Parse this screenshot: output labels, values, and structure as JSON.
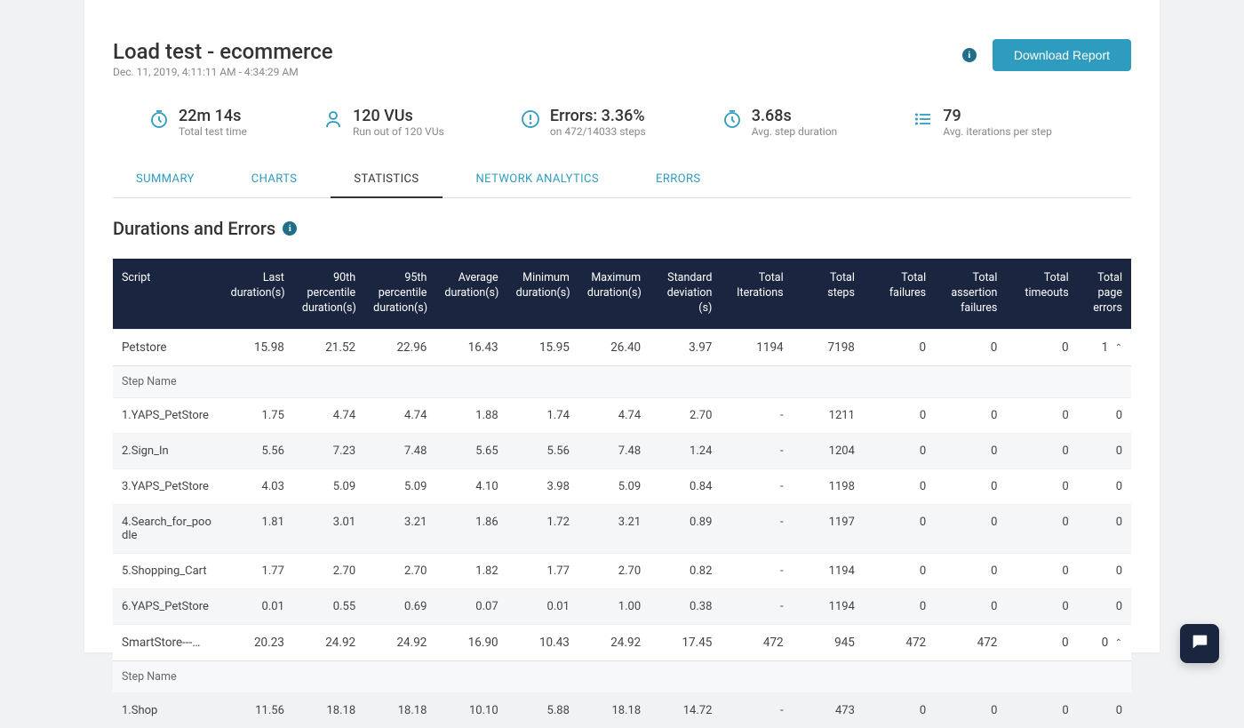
{
  "header": {
    "title": "Load test - ecommerce",
    "subtitle": "Dec. 11, 2019, 4:11:11 AM - 4:34:29 AM",
    "download_label": "Download Report"
  },
  "metrics": [
    {
      "icon": "clock",
      "value": "22m 14s",
      "label": "Total test time"
    },
    {
      "icon": "user",
      "value": "120 VUs",
      "label": "Run out of 120 VUs"
    },
    {
      "icon": "alert",
      "value": "Errors: 3.36%",
      "label": "on 472/14033 steps"
    },
    {
      "icon": "clock",
      "value": "3.68s",
      "label": "Avg. step duration"
    },
    {
      "icon": "list",
      "value": "79",
      "label": "Avg. iterations per step"
    }
  ],
  "tabs": [
    {
      "label": "SUMMARY",
      "active": false
    },
    {
      "label": "CHARTS",
      "active": false
    },
    {
      "label": "STATISTICS",
      "active": true
    },
    {
      "label": "NETWORK ANALYTICS",
      "active": false
    },
    {
      "label": "ERRORS",
      "active": false
    }
  ],
  "section": {
    "title": "Durations and Errors"
  },
  "table": {
    "columns": [
      "Script",
      "Last duration(s)",
      "90th percentile duration(s)",
      "95th percentile duration(s)",
      "Average duration(s)",
      "Minimum duration(s)",
      "Maximum duration(s)",
      "Standard deviation (s)",
      "Total Iterations",
      "Total steps",
      "Total failures",
      "Total assertion failures",
      "Total timeouts",
      "Total page errors"
    ],
    "step_header_label": "Step Name",
    "rows": [
      {
        "kind": "script",
        "cells": [
          "Petstore",
          "15.98",
          "21.52",
          "22.96",
          "16.43",
          "15.95",
          "26.40",
          "3.97",
          "1194",
          "7198",
          "0",
          "0",
          "0",
          "1"
        ]
      },
      {
        "kind": "step-header"
      },
      {
        "kind": "step",
        "cells": [
          "1.YAPS_PetStore",
          "1.75",
          "4.74",
          "4.74",
          "1.88",
          "1.74",
          "4.74",
          "2.70",
          "-",
          "1211",
          "0",
          "0",
          "0",
          "0"
        ]
      },
      {
        "kind": "step-alt",
        "cells": [
          "2.Sign_In",
          "5.56",
          "7.23",
          "7.48",
          "5.65",
          "5.56",
          "7.48",
          "1.24",
          "-",
          "1204",
          "0",
          "0",
          "0",
          "0"
        ]
      },
      {
        "kind": "step",
        "cells": [
          "3.YAPS_PetStore",
          "4.03",
          "5.09",
          "5.09",
          "4.10",
          "3.98",
          "5.09",
          "0.84",
          "-",
          "1198",
          "0",
          "0",
          "0",
          "0"
        ]
      },
      {
        "kind": "step-alt",
        "cells": [
          "4.Search_for_poodle",
          "1.81",
          "3.01",
          "3.21",
          "1.86",
          "1.72",
          "3.21",
          "0.89",
          "-",
          "1197",
          "0",
          "0",
          "0",
          "0"
        ]
      },
      {
        "kind": "step",
        "cells": [
          "5.Shopping_Cart",
          "1.77",
          "2.70",
          "2.70",
          "1.82",
          "1.77",
          "2.70",
          "0.82",
          "-",
          "1194",
          "0",
          "0",
          "0",
          "0"
        ]
      },
      {
        "kind": "step-alt",
        "cells": [
          "6.YAPS_PetStore",
          "0.01",
          "0.55",
          "0.69",
          "0.07",
          "0.01",
          "1.00",
          "0.38",
          "-",
          "1194",
          "0",
          "0",
          "0",
          "0"
        ]
      },
      {
        "kind": "script",
        "cells": [
          "SmartStore---…",
          "20.23",
          "24.92",
          "24.92",
          "16.90",
          "10.43",
          "24.92",
          "17.45",
          "472",
          "945",
          "472",
          "472",
          "0",
          "0"
        ]
      },
      {
        "kind": "step-header"
      },
      {
        "kind": "step",
        "cells": [
          "1.Shop",
          "11.56",
          "18.18",
          "18.18",
          "10.10",
          "5.88",
          "18.18",
          "14.72",
          "-",
          "473",
          "0",
          "0",
          "0",
          "0"
        ]
      }
    ]
  }
}
